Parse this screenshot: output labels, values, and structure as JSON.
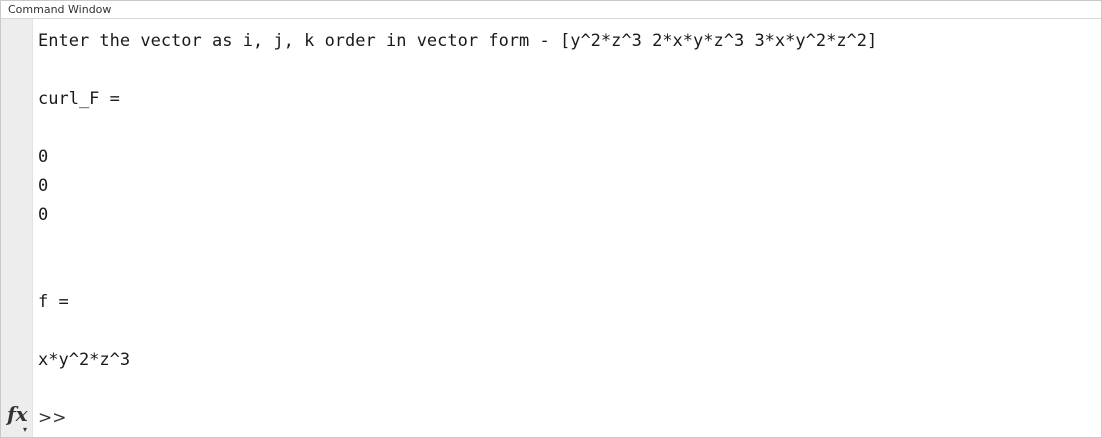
{
  "window": {
    "title": "Command Window"
  },
  "output": {
    "input_line": "Enter the vector as i, j, k order in vector form - [y^2*z^3 2*x*y*z^3 3*x*y^2*z^2]",
    "curl_header": "curl_F =",
    "curl_values": [
      "0",
      "0",
      "0"
    ],
    "f_header": "f =",
    "f_value": "x*y^2*z^3"
  },
  "prompt": {
    "fx_label": "fx",
    "symbol": ">>"
  }
}
